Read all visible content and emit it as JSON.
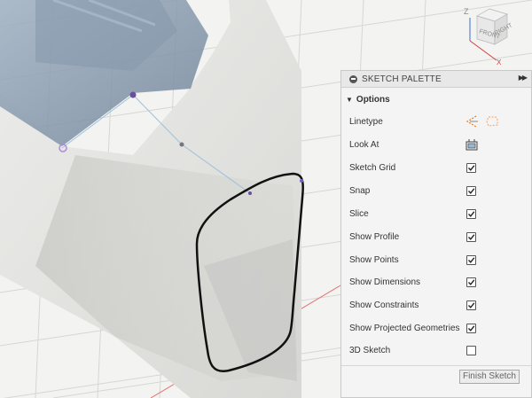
{
  "viewcube": {
    "top_label": "Z",
    "front_label": "FRONT",
    "right_label": "RIGHT"
  },
  "palette": {
    "title": "SKETCH PALETTE",
    "section_title": "Options",
    "rows": [
      {
        "label": "Linetype",
        "control": "icons"
      },
      {
        "label": "Look At",
        "control": "icon"
      },
      {
        "label": "Sketch Grid",
        "checked": true
      },
      {
        "label": "Snap",
        "checked": true
      },
      {
        "label": "Slice",
        "checked": true
      },
      {
        "label": "Show Profile",
        "checked": true
      },
      {
        "label": "Show Points",
        "checked": true
      },
      {
        "label": "Show Dimensions",
        "checked": true
      },
      {
        "label": "Show Constraints",
        "checked": true
      },
      {
        "label": "Show Projected Geometries",
        "checked": true
      },
      {
        "label": "3D Sketch",
        "checked": false
      }
    ],
    "finish_button": "Finish Sketch"
  },
  "colors": {
    "accent": "#f07a1a",
    "grid": "#d0d0d0",
    "axis_red": "#e05050",
    "sketch_point": "#7755aa"
  },
  "icons": [
    "linetype-construction-icon",
    "linetype-centerline-icon",
    "look-at-icon",
    "checkmark-icon",
    "collapse-icon",
    "expand-icon",
    "viewcube-home-icon"
  ]
}
